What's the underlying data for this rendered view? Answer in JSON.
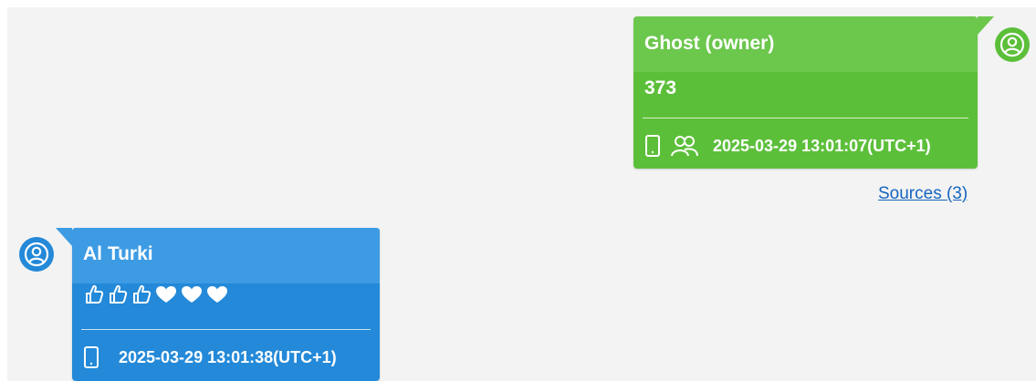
{
  "colors": {
    "owner_bubble": "#5cbf3a",
    "owner_header": "#6cc74d",
    "contact_bubble": "#2389d8",
    "contact_header": "#3d9be3",
    "link": "#1565c0"
  },
  "messages": [
    {
      "sender": "Ghost (owner)",
      "text": "373",
      "timestamp": "2025-03-29 13:01:07(UTC+1)",
      "icons": [
        "phone-icon",
        "group-icon"
      ],
      "avatar": "user-avatar-icon"
    },
    {
      "sender": "Al Turki",
      "reactions": [
        "thumbs-up",
        "thumbs-up",
        "thumbs-up",
        "heart",
        "heart",
        "heart"
      ],
      "timestamp": "2025-03-29 13:01:38(UTC+1)",
      "icons": [
        "phone-icon"
      ],
      "avatar": "user-avatar-icon"
    }
  ],
  "sources_link": "Sources (3)"
}
